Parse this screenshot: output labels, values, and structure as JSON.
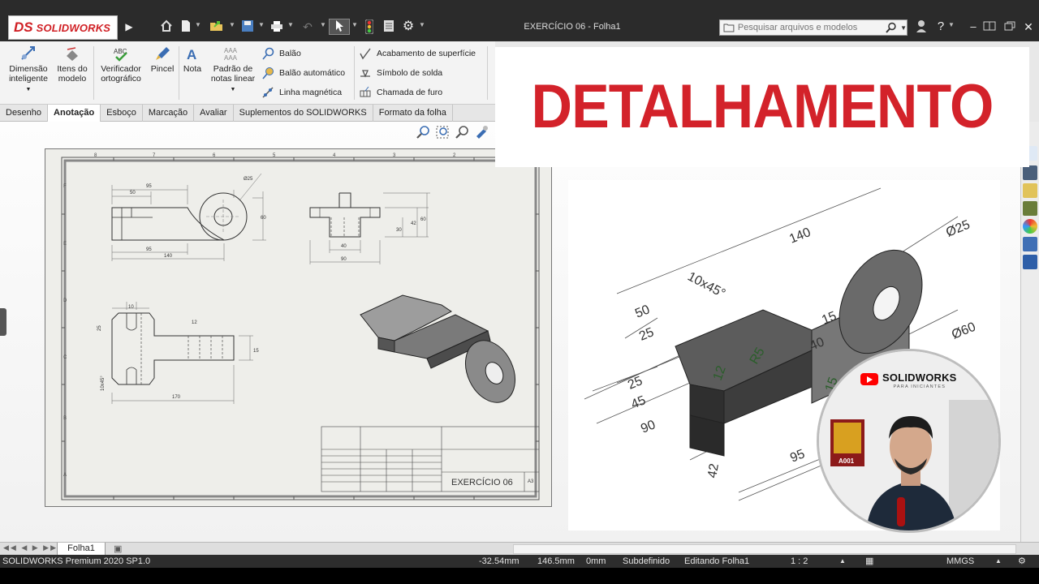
{
  "app": {
    "brand_mark": "DS",
    "brand_name": "SOLIDWORKS",
    "document_title": "EXERCÍCIO 06 - Folha1",
    "search_placeholder": "Pesquisar arquivos e modelos"
  },
  "command_manager": {
    "big_commands": [
      {
        "label_line1": "Dimensão",
        "label_line2": "inteligente"
      },
      {
        "label_line1": "Itens do",
        "label_line2": "modelo"
      },
      {
        "label_line1": "Verificador",
        "label_line2": "ortográfico"
      },
      {
        "label_line1": "Pincel",
        "label_line2": ""
      },
      {
        "label_line1": "Nota",
        "label_line2": ""
      },
      {
        "label_line1": "Padrão de",
        "label_line2": "notas linear"
      }
    ],
    "small_commands_col1": [
      "Balão",
      "Balão automático",
      "Linha magnética"
    ],
    "small_commands_col2": [
      "Acabamento de superfície",
      "Símbolo de solda",
      "Chamada de furo"
    ]
  },
  "tabs": [
    "Desenho",
    "Anotação",
    "Esboço",
    "Marcação",
    "Avaliar",
    "Suplementos do SOLIDWORKS",
    "Formato da folha"
  ],
  "active_tab": "Anotação",
  "drawing": {
    "zone_cols": [
      "8",
      "7",
      "6",
      "5",
      "4",
      "3",
      "2",
      "1"
    ],
    "zone_rows": [
      "F",
      "E",
      "D",
      "C",
      "B",
      "A"
    ],
    "front_dims": [
      "95",
      "50",
      "Ø25",
      "95",
      "140",
      "60"
    ],
    "top_dims": [
      "40",
      "30",
      "42",
      "60",
      "90"
    ],
    "side_dims": [
      "10",
      "25",
      "12",
      "15",
      "10x45°",
      "170"
    ],
    "title_block_title": "EXERCÍCIO 06",
    "title_block_size": "A3"
  },
  "overlay": {
    "banner_text": "DETALHAMENTO",
    "iso_labels": [
      "140",
      "Ø25",
      "10x45°",
      "50",
      "25",
      "15",
      "40",
      "Ø60",
      "R5",
      "12",
      "15",
      "25",
      "45",
      "90",
      "95",
      "42"
    ],
    "channel_name": "SOLIDWORKS",
    "channel_tagline": "PARA INICIANTES",
    "poster_text": "A001"
  },
  "sheet_tab": "Folha1",
  "status": {
    "product": "SOLIDWORKS Premium 2020 SP1.0",
    "x": "-32.54mm",
    "y": "146.5mm",
    "z": "0mm",
    "state": "Subdefinido",
    "editing": "Editando Folha1",
    "scale": "1 : 2",
    "units": "MMGS"
  }
}
